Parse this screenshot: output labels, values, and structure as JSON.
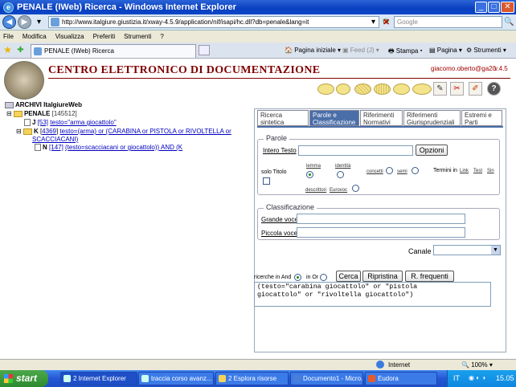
{
  "window": {
    "title": "PENALE (IWeb) Ricerca - Windows Internet Explorer"
  },
  "address": {
    "url": "http://www.italgiure.giustizia.it/xway-4.5.9/application/nif/isapi/hc.dll?db=penale&lang=it",
    "search_placeholder": "Google"
  },
  "menu": [
    "File",
    "Modifica",
    "Visualizza",
    "Preferiti",
    "Strumenti",
    "?"
  ],
  "tab": {
    "label": "PENALE (IWeb) Ricerca"
  },
  "ie_toolbar": {
    "home": "Pagina iniziale",
    "feed": "Feed (J)",
    "print": "Stampa",
    "page": "Pagina",
    "tools": "Strumenti"
  },
  "header": {
    "title": "CENTRO ELETTRONICO DI DOCUMENTAZIONE",
    "user": "giacomo.oberto@ga20",
    "version": "v.4.5"
  },
  "tree": {
    "root": "ARCHIVI ItalgiureWeb",
    "archive": "PENALE",
    "archive_count": "[145512]",
    "j_tag": "J",
    "j_count": "[53]",
    "j_query": "testo=\"arma giocattolo\"",
    "k_tag": "K",
    "k_count": "4369",
    "k_query_1": "testo=(arma) or (CARABINA or PISTOLA or RIVOLTELLA or",
    "k_query_2": "SCACCIACANI)",
    "n_tag": "N",
    "n_count": "[147]",
    "n_query": "(testo=scacciacani or giocattolo)) AND (K"
  },
  "tabs": [
    {
      "label1": "Ricerca sintetica",
      "label2": ""
    },
    {
      "label1": "Parole e",
      "label2": "Classificazione"
    },
    {
      "label1": "Riferimenti",
      "label2": "Normativi"
    },
    {
      "label1": "Riferimenti",
      "label2": "Giurisprudenziali"
    },
    {
      "label1": "Estremi e",
      "label2": "Parti"
    }
  ],
  "parole": {
    "legend": "Parole",
    "intero_testo": "Intero Testo",
    "opzioni": "Opzioni",
    "solo_titolo": "solo Titolo",
    "lemma": "lemma",
    "identita": "identità",
    "concetti": "concetti",
    "semi": "semi",
    "termini_in": "Termini in",
    "link": "Link",
    "test": "Test",
    "sin": "Sin",
    "descrittori": "descrittori",
    "eurovoc": "Eurovoc"
  },
  "classificazione": {
    "legend": "Classificazione",
    "grande_voce": "Grande voce",
    "piccola_voce": "Piccola voce"
  },
  "canale": {
    "label": "Canale",
    "value": ""
  },
  "actions": {
    "and_label": "ricerche in And",
    "or_label": "in Or",
    "cerca": "Cerca",
    "ripristina": "Ripristina",
    "frequenti": "R. frequenti"
  },
  "query_text": "(testo=\"carabina giocattolo\" or \"pistola\ngiocattolo\" or \"rivoltella giocattolo\")",
  "status": {
    "zone": "Internet",
    "zoom": "100%"
  },
  "taskbar": {
    "start": "start",
    "items": [
      "2 Internet Explorer",
      "traccia corso avanz...",
      "2 Esplora risorse",
      "Documento1 - Micro...",
      "Eudora"
    ],
    "lang": "IT",
    "clock": "15.05"
  },
  "colors": {
    "accent": "#800000",
    "tab_active": "#4a6ea8",
    "link": "#0000c0"
  }
}
